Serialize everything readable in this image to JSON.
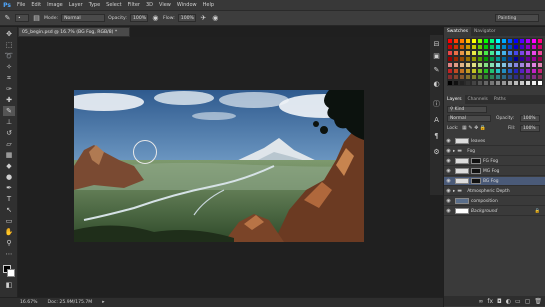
{
  "app": {
    "logo": "Ps"
  },
  "menu": [
    "File",
    "Edit",
    "Image",
    "Layer",
    "Type",
    "Select",
    "Filter",
    "3D",
    "View",
    "Window",
    "Help"
  ],
  "options": {
    "mode_label": "Mode:",
    "mode_value": "Normal",
    "opacity_label": "Opacity:",
    "opacity_value": "100%",
    "flow_label": "Flow:",
    "flow_value": "100%",
    "workspace": "Painting"
  },
  "document": {
    "tab_title": "05_begin.psd @ 16.7% (BG Fog, RGB/8) *",
    "zoom": "16.67%",
    "doc_size": "Doc: 25.9M/175.7M"
  },
  "panels": {
    "swatches_tab": "Swatches",
    "navigator_tab": "Navigator",
    "layers_tab": "Layers",
    "channels_tab": "Channels",
    "paths_tab": "Paths"
  },
  "layers_panel": {
    "kind": "Kind",
    "blend_mode": "Normal",
    "opacity_label": "Opacity:",
    "opacity_value": "100%",
    "lock_label": "Lock:",
    "fill_label": "Fill:",
    "fill_value": "100%",
    "layers": [
      {
        "name": "leaves",
        "type": "layer",
        "selected": false
      },
      {
        "name": "Fog",
        "type": "group",
        "selected": false
      },
      {
        "name": "FG Fog",
        "type": "layer",
        "selected": false
      },
      {
        "name": "MG Fog",
        "type": "layer",
        "selected": false
      },
      {
        "name": "BG Fog",
        "type": "layer",
        "selected": true
      },
      {
        "name": "Atmospheric Depth",
        "type": "group",
        "selected": false
      },
      {
        "name": "composition",
        "type": "layer",
        "selected": false
      },
      {
        "name": "Background",
        "type": "layer",
        "selected": false
      }
    ]
  }
}
